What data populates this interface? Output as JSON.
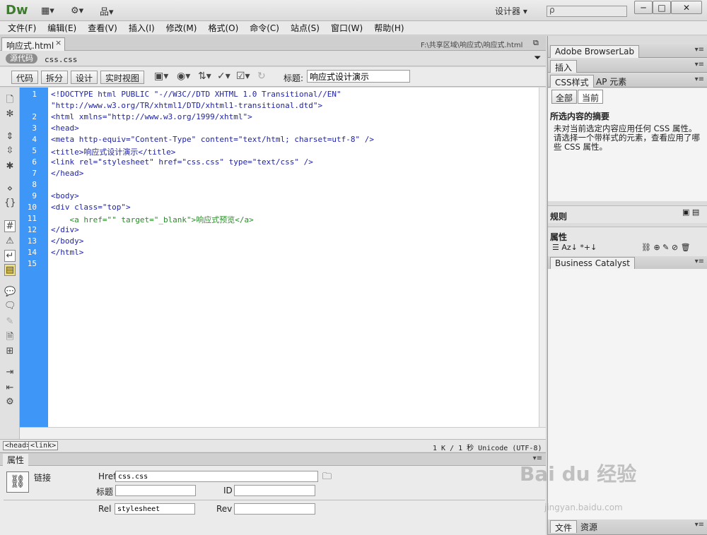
{
  "app": {
    "logo": "Dw",
    "workspace": "设计器 ▾",
    "search_placeholder": "ρ",
    "window_controls": [
      "─",
      "□",
      "✕"
    ]
  },
  "menu": [
    "文件(F)",
    "编辑(E)",
    "查看(V)",
    "插入(I)",
    "修改(M)",
    "格式(O)",
    "命令(C)",
    "站点(S)",
    "窗口(W)",
    "帮助(H)"
  ],
  "document": {
    "tab_label": "响应式.html",
    "tab_close": "×",
    "path": "F:\\共享区域\\响应式\\响应式.html",
    "source_code_label": "源代码",
    "related_file": "css.css"
  },
  "view_toolbar": {
    "buttons": [
      "代码",
      "拆分",
      "设计",
      "实时视图"
    ],
    "title_label": "标题:",
    "title_value": "响应式设计演示"
  },
  "code_lines": [
    "<!DOCTYPE html PUBLIC \"-//W3C//DTD XHTML 1.0 Transitional//EN\"",
    "\"http://www.w3.org/TR/xhtml1/DTD/xhtml1-transitional.dtd\">",
    "<html xmlns=\"http://www.w3.org/1999/xhtml\">",
    "<head>",
    "<meta http-equiv=\"Content-Type\" content=\"text/html; charset=utf-8\" />",
    "<title>响应式设计演示</title>",
    "<link rel=\"stylesheet\" href=\"css.css\" type=\"text/css\" />",
    "</head>",
    "",
    "<body>",
    "<div class=\"top\">",
    "    <a href=\"\" target=\"_blank\">响应式预览</a>",
    "</div>",
    "</body>",
    "</html>",
    ""
  ],
  "line_numbers": [
    "1",
    "",
    "2",
    "3",
    "4",
    "5",
    "6",
    "7",
    "8",
    "9",
    "10",
    "11",
    "12",
    "13",
    "14",
    "15"
  ],
  "status": {
    "crumbs": [
      "<head>",
      "<link>"
    ],
    "info": "1 K / 1 秒 Unicode (UTF-8)"
  },
  "properties": {
    "tab": "属性",
    "element_label": "链接",
    "href_label": "Href",
    "href_value": "css.css",
    "title_label": "标题",
    "title_value": "",
    "id_label": "ID",
    "id_value": "",
    "rel_label": "Rel",
    "rel_value": "stylesheet",
    "rev_label": "Rev",
    "rev_value": ""
  },
  "right_panel": {
    "browserlab": "Adobe BrowserLab",
    "insert": "插入",
    "css_tab": "CSS样式",
    "ap_tab": "AP 元素",
    "all_btn": "全部",
    "current_btn": "当前",
    "summary_title": "所选内容的摘要",
    "summary_text": "未对当前选定内容应用任何 CSS 属性。请选择一个带样式的元素，查看应用了哪些 CSS 属性。",
    "rules_title": "规则",
    "props_title": "属性",
    "business_catalyst": "Business Catalyst",
    "files_tab": "文件",
    "assets_tab": "资源"
  },
  "watermark": {
    "brand": "Bai du 经验",
    "url": "jingyan.baidu.com"
  }
}
